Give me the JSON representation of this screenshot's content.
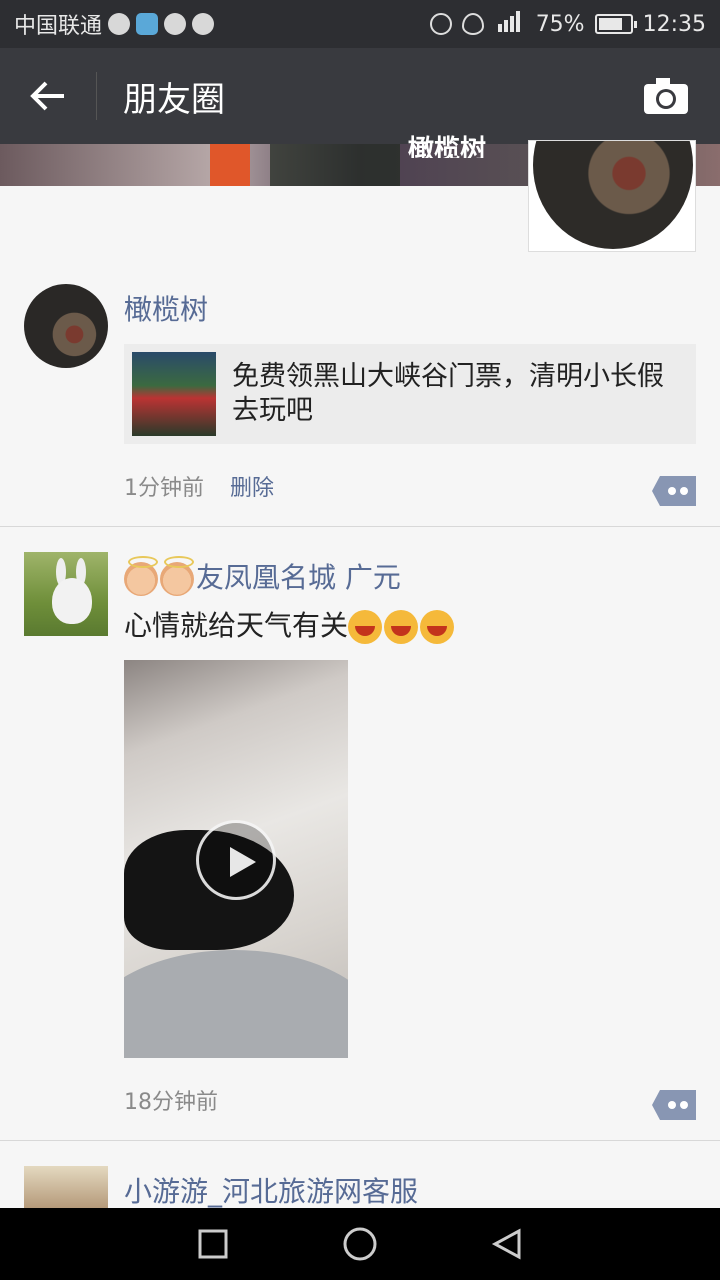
{
  "status_bar": {
    "carrier": "中国联通",
    "battery": "75%",
    "time": "12:35",
    "battery_level": 0.75
  },
  "header": {
    "title": "朋友圈",
    "back_icon": "arrow-left-icon",
    "camera_icon": "camera-icon"
  },
  "cover": {
    "owner_name": "橄榄树"
  },
  "posts": [
    {
      "author": "橄榄树",
      "share_title": "免费领黑山大峡谷门票，清明小长假去玩吧",
      "time": "1分钟前",
      "delete_label": "删除"
    },
    {
      "author": "友凤凰名城 广元",
      "text": "心情就给天气有关",
      "time": "18分钟前"
    },
    {
      "author": "小游游_河北旅游网客服"
    }
  ],
  "colors": {
    "accent": "#576b95",
    "navbar": "#393a3f",
    "statusbar": "#2d2e32"
  }
}
